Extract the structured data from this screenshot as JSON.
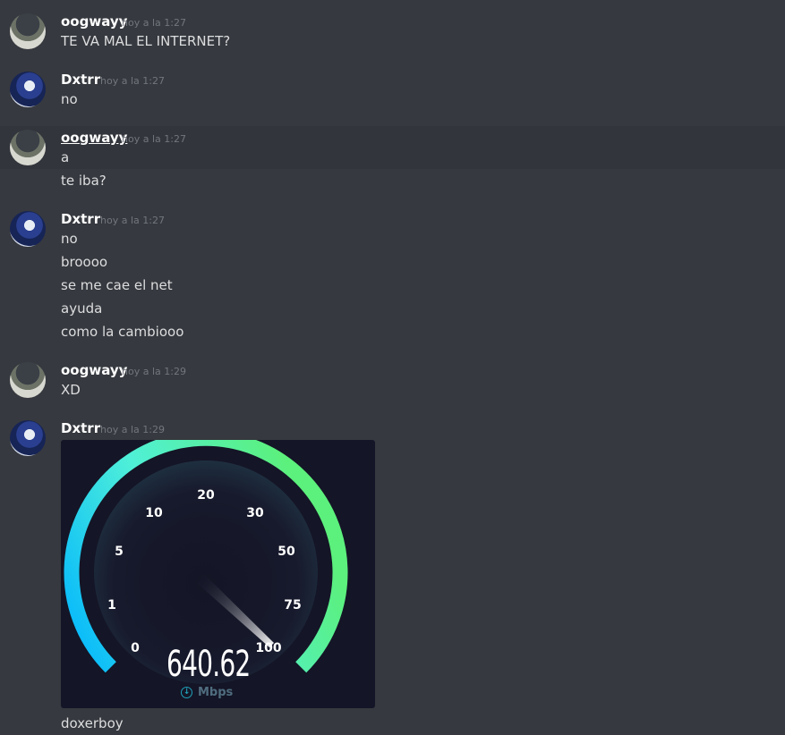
{
  "messages": [
    {
      "user": "oogwayy",
      "time": "hoy a la 1:27",
      "lines": [
        "TE VA MAL EL INTERNET?"
      ]
    },
    {
      "user": "Dxtrr",
      "time": "hoy a la 1:27",
      "lines": [
        "no"
      ]
    },
    {
      "user": "oogwayy",
      "time": "hoy a la 1:27",
      "lines": [
        "a",
        "te iba?"
      ]
    },
    {
      "user": "Dxtrr",
      "time": "hoy a la 1:27",
      "lines": [
        "no",
        "broooo",
        "se me cae el net",
        "ayuda",
        "como la cambiooo"
      ]
    },
    {
      "user": "oogwayy",
      "time": "hoy a la 1:29",
      "lines": [
        "XD"
      ]
    },
    {
      "user": "Dxtrr",
      "time": "hoy a la 1:29",
      "lines": [
        "doxerboy"
      ]
    }
  ],
  "speedtest": {
    "ticks": [
      "0",
      "1",
      "5",
      "10",
      "20",
      "30",
      "50",
      "75",
      "100"
    ],
    "value": "640.62",
    "unit": "Mbps"
  },
  "colors": {
    "background": "#36393f",
    "username": "#ffffff",
    "timestamp": "#72767d",
    "text": "#dcddde",
    "gauge_start": "#00b4ff",
    "gauge_end": "#5cf07c"
  }
}
